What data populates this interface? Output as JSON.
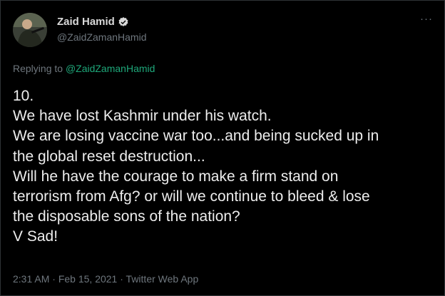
{
  "author": {
    "name": "Zaid Hamid",
    "handle": "@ZaidZamanHamid"
  },
  "more_glyph": "···",
  "reply": {
    "prefix": "Replying to ",
    "to": "@ZaidZamanHamid"
  },
  "tweet_lines": [
    "10.",
    "We have lost Kashmir under his watch.",
    "We are losing vaccine war too...and being sucked up in",
    "the global reset destruction...",
    "Will he have the courage to make a firm stand on",
    "terrorism from Afg? or will we continue to bleed & lose",
    "the disposable sons of the nation?",
    "V Sad!"
  ],
  "meta": {
    "time": "2:31 AM",
    "sep1": " · ",
    "date": "Feb 15, 2021",
    "sep2": " · ",
    "source": "Twitter Web App"
  },
  "colors": {
    "background": "#000000",
    "link": "#1ea87a",
    "muted": "#6e767d",
    "verified": "#1d9bf0"
  }
}
